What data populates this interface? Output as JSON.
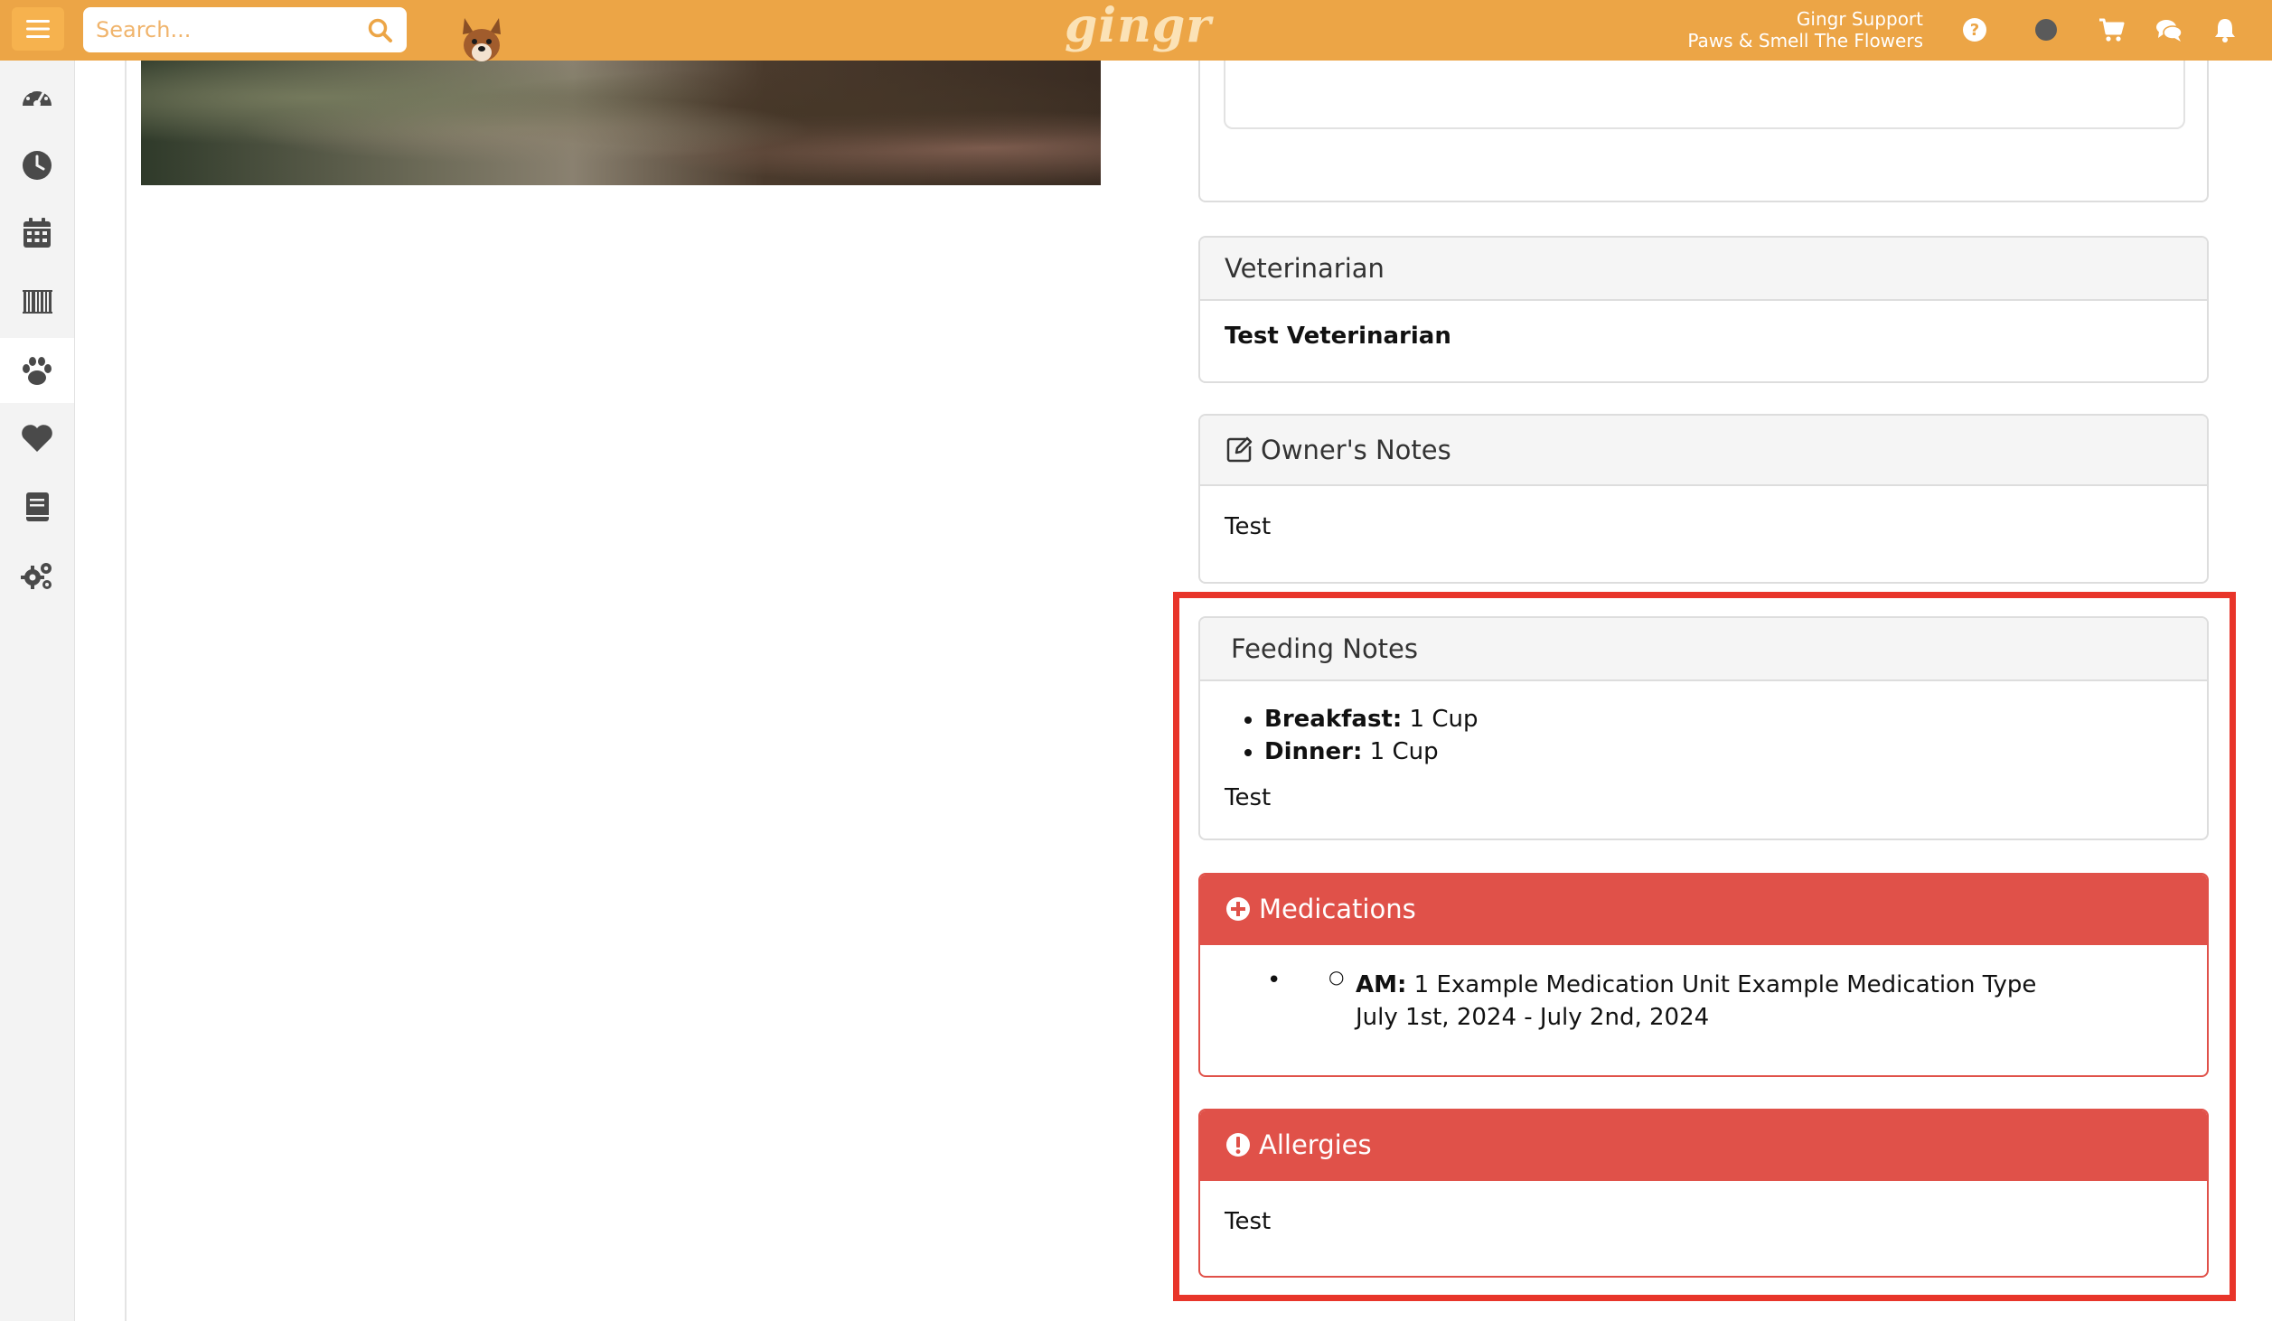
{
  "topbar": {
    "search_placeholder": "Search...",
    "logo_text": "gingr",
    "user_name": "Gingr Support",
    "location": "Paws & Smell The Flowers"
  },
  "sidebar": {
    "items": [
      {
        "icon": "dashboard-icon"
      },
      {
        "icon": "clock-icon"
      },
      {
        "icon": "calendar-icon"
      },
      {
        "icon": "barcode-icon"
      },
      {
        "icon": "paw-icon",
        "active": true
      },
      {
        "icon": "heart-icon"
      },
      {
        "icon": "book-icon"
      },
      {
        "icon": "gears-icon"
      }
    ]
  },
  "veterinarian": {
    "title": "Veterinarian",
    "name": "Test Veterinarian"
  },
  "owners_notes": {
    "title": "Owner's Notes",
    "text": "Test"
  },
  "feeding_notes": {
    "title": "Feeding Notes",
    "items": [
      {
        "label": "Breakfast:",
        "value": " 1 Cup"
      },
      {
        "label": "Dinner:",
        "value": " 1 Cup"
      }
    ],
    "text": "Test"
  },
  "medications": {
    "title": "Medications",
    "entries": [
      {
        "label": "AM:",
        "value": " 1 Example Medication Unit Example Medication Type",
        "dates": "July 1st, 2024 - July 2nd, 2024"
      }
    ]
  },
  "allergies": {
    "title": "Allergies",
    "text": "Test"
  },
  "colors": {
    "topbar": "#eca546",
    "alert_red": "#e05149",
    "highlight_red": "#e8352a"
  }
}
